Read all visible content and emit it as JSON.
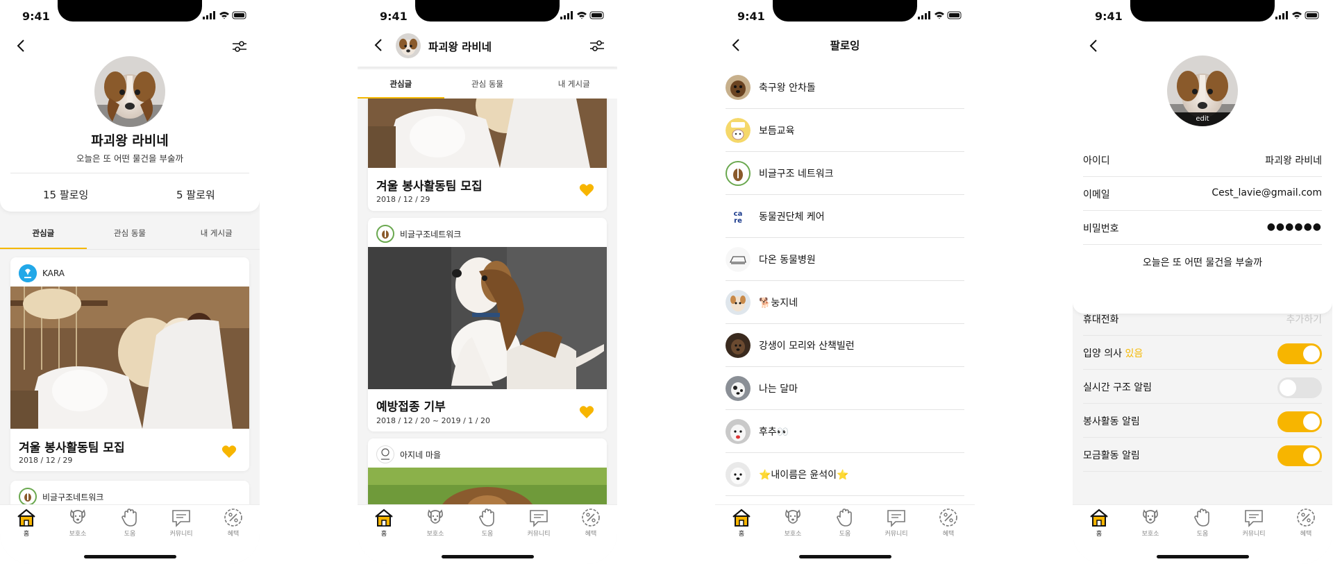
{
  "status": {
    "time": "9:41"
  },
  "nav": {
    "items": [
      {
        "label": "홈",
        "icon": "home-icon"
      },
      {
        "label": "보호소",
        "icon": "dog-icon"
      },
      {
        "label": "도움",
        "icon": "hand-icon"
      },
      {
        "label": "커뮤니티",
        "icon": "chat-icon"
      },
      {
        "label": "혜택",
        "icon": "percent-icon"
      }
    ]
  },
  "tabs": [
    "관심글",
    "관심 동물",
    "내 게시글"
  ],
  "profile": {
    "name": "파괴왕 라비네",
    "bio": "오늘은 또 어떤 물건을 부술까",
    "following": "15 팔로잉",
    "followers": "5 팔로워"
  },
  "screen1": {
    "post1": {
      "author": "KARA",
      "title": "겨울 봉사활동팀 모집",
      "date": "2018 / 12 / 29"
    },
    "post2": {
      "author": "비글구조네트워크"
    }
  },
  "screen2": {
    "header_name": "파괴왕 라비네",
    "post1": {
      "title": "겨울 봉사활동팀 모집",
      "date": "2018 / 12 / 29"
    },
    "post2": {
      "author": "비글구조네트워크",
      "title": "예방접종 기부",
      "date": "2018 / 12 / 20 ~ 2019 / 1 / 20"
    },
    "post3": {
      "author": "아지네 마을"
    }
  },
  "screen3": {
    "title": "팔로잉",
    "items": [
      "축구왕 안차돌",
      "보듬교육",
      "비글구조 네트워크",
      "동물권단체 케어",
      "다온 동물병원",
      "🐕눙지네",
      "강생이 모리와 산책빌런",
      "나는 달마",
      "후추👀",
      "⭐내이름은 윤석이⭐"
    ]
  },
  "screen4": {
    "edit": "edit",
    "id_label": "아이디",
    "id_value": "파괴왕 라비네",
    "email_label": "이메일",
    "email_value": "Cest_lavie@gmail.com",
    "pw_label": "비밀번호",
    "pw_value": "●●●●●●",
    "bio": "오늘은 또 어떤 물건을 부술까",
    "phone_label": "휴대전화",
    "phone_placeholder": "추가하기",
    "adopt_label": "입양 의사",
    "adopt_value": "있음",
    "rescue_label": "실시간 구조 알림",
    "volunteer_label": "봉사활동 알림",
    "fund_label": "모금활동 알림",
    "toggles": {
      "adopt": true,
      "rescue": false,
      "volunteer": true,
      "fund": true
    }
  },
  "colors": {
    "accent": "#f7b500",
    "adopt_value": "#f5b800"
  }
}
